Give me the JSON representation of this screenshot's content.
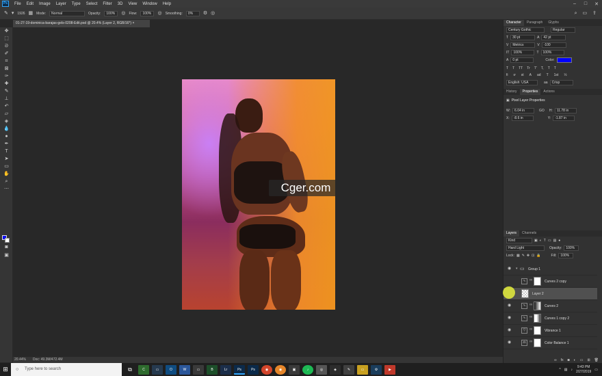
{
  "app": {
    "name": "Ps"
  },
  "menu": [
    "File",
    "Edit",
    "Image",
    "Layer",
    "Type",
    "Select",
    "Filter",
    "3D",
    "View",
    "Window",
    "Help"
  ],
  "options": {
    "brush_size": "1926",
    "mode_label": "Mode:",
    "mode_value": "Normal",
    "opacity_label": "Opacity:",
    "opacity_value": "100%",
    "flow_label": "Flow:",
    "flow_value": "100%",
    "smoothing_label": "Smoothing:",
    "smoothing_value": "0%"
  },
  "document": {
    "tab_title": "01-27-19-dominica-barajas-gels-0208-Edit.psd @ 20.4% (Layer 2, RGB/16*)",
    "zoom": "20.44%",
    "doc_size": "Doc: 49.3M/472.4M"
  },
  "watermark": {
    "text": "Cger.com"
  },
  "colors": {
    "foreground": "#0c0cf0",
    "background": "#ffffff",
    "accent": "#31a8ff"
  },
  "character": {
    "tabs": [
      "Character",
      "Paragraph",
      "Glyphs"
    ],
    "font_family": "Century Gothic",
    "font_style": "Regular",
    "font_size": "30 pt",
    "leading": "42 pt",
    "kerning": "Metrics",
    "tracking": "-100",
    "vscale": "100%",
    "hscale": "100%",
    "baseline": "0 pt",
    "color_label": "Color:",
    "text_color": "#0000ff",
    "language": "English: USA",
    "antialias": "Crisp",
    "style_buttons": [
      "T",
      "T",
      "TT",
      "Tr",
      "T'",
      "T,",
      "T",
      "T"
    ]
  },
  "properties": {
    "tabs": [
      "History",
      "Properties",
      "Actions"
    ],
    "title": "Pixel Layer Properties",
    "w_label": "W:",
    "w": "6.04 in",
    "h_label": "H:",
    "h": "11.78 in",
    "x_label": "X:",
    "x": "-8.6 in",
    "y_label": "Y:",
    "y": "-1.87 in",
    "link": "GO"
  },
  "layers": {
    "tabs": [
      "Layers",
      "Channels"
    ],
    "filter": "Kind",
    "blend_mode": "Hard Light",
    "opacity_label": "Opacity:",
    "opacity": "100%",
    "lock_label": "Lock:",
    "fill_label": "Fill:",
    "fill": "100%",
    "items": [
      {
        "name": "Group 1",
        "type": "group",
        "visible": true
      },
      {
        "name": "Curves 2 copy",
        "type": "curves",
        "visible": false
      },
      {
        "name": "Layer 2",
        "type": "pixel",
        "visible": false,
        "selected": true
      },
      {
        "name": "Curves 2",
        "type": "curves",
        "visible": true
      },
      {
        "name": "Curves 1 copy 2",
        "type": "curves",
        "visible": true
      },
      {
        "name": "Vibrance 1",
        "type": "vibrance",
        "visible": true
      },
      {
        "name": "Color Balance 1",
        "type": "balance",
        "visible": true
      }
    ]
  },
  "taskbar": {
    "search_placeholder": "Type here to search",
    "time": "9:43 PM",
    "date": "2/27/2019"
  }
}
